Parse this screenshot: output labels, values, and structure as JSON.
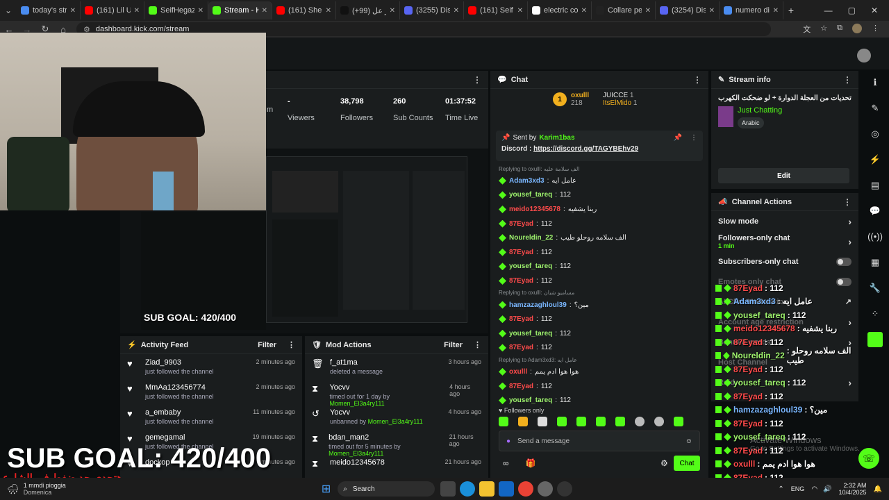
{
  "tabs": [
    {
      "label": "today's strea",
      "color": "#4a8cf0"
    },
    {
      "label": "(161) Lil Uzi",
      "color": "#ff0000"
    },
    {
      "label": "SeifHegazy",
      "color": "#53fc18"
    },
    {
      "label": "Stream - Kick",
      "color": "#53fc18",
      "active": true
    },
    {
      "label": "(161) Sherine",
      "color": "#ff0000"
    },
    {
      "label": "(+99) عائز عل",
      "color": "#111111"
    },
    {
      "label": "(3255) Disco",
      "color": "#5865f2"
    },
    {
      "label": "(161) Seif He",
      "color": "#ff0000"
    },
    {
      "label": "electric colla",
      "color": "#ffffff"
    },
    {
      "label": "Collare per",
      "color": "#222222"
    },
    {
      "label": "(3254) Disco",
      "color": "#5865f2"
    },
    {
      "label": "numero di u",
      "color": "#4a8cf0"
    }
  ],
  "browser": {
    "url": "dashboard.kick.com/stream"
  },
  "stats": [
    {
      "value": "-",
      "label": "Viewers"
    },
    {
      "value": "38,798",
      "label": "Followers"
    },
    {
      "value": "260",
      "label": "Sub Counts"
    },
    {
      "value": "01:37:52",
      "label": "Time Live"
    }
  ],
  "stats_cut_label": "m",
  "overlay": {
    "sub_goal": "SUB GOAL: 420/400",
    "sub_goal_small": "SUB GOAL: 420/400",
    "arabic": "هتحدي حد ضغط في الشارع"
  },
  "activity": {
    "title": "Activity Feed",
    "filter": "Filter",
    "items": [
      {
        "name": "Ziad_9903",
        "sub": "just followed the channel",
        "time": "2 minutes ago"
      },
      {
        "name": "MmAa123456774",
        "sub": "just followed the channel",
        "time": "2 minutes ago"
      },
      {
        "name": "a_embaby",
        "sub": "just followed the channel",
        "time": "11 minutes ago"
      },
      {
        "name": "gemegamal",
        "sub": "just followed the channel",
        "time": "19 minutes ago"
      },
      {
        "name": "dockop",
        "sub": "",
        "time": "minutes ago"
      }
    ]
  },
  "mod": {
    "title": "Mod Actions",
    "filter": "Filter",
    "items": [
      {
        "icon": "trash-icon",
        "glyph": "🗑",
        "name": "f_at1ma",
        "sub": "deleted a message",
        "by": "",
        "time": "3 hours ago"
      },
      {
        "icon": "hourglass-icon",
        "glyph": "⧗",
        "name": "Yocvv",
        "sub": "timed out for 1 day by ",
        "by": "Momen_El3a4ry111",
        "time": "4 hours ago"
      },
      {
        "icon": "unban-icon",
        "glyph": "↺",
        "name": "Yocvv",
        "sub": "unbanned by ",
        "by": "Momen_El3a4ry111",
        "time": "4 hours ago"
      },
      {
        "icon": "hourglass-icon",
        "glyph": "⧗",
        "name": "bdan_man2",
        "sub": "timed out for 5 minutes by ",
        "by": "Momen_El3a4ry111",
        "time": "21 hours ago"
      },
      {
        "icon": "hourglass-icon",
        "glyph": "⧗",
        "name": "meido12345678",
        "sub": "",
        "by": "",
        "time": "21 hours ago"
      }
    ]
  },
  "chat": {
    "title": "Chat",
    "leaderboard": [
      {
        "rank": "1",
        "name": "oxulll",
        "count": "218"
      },
      {
        "name": "JUICCE",
        "count": "1"
      },
      {
        "name": "ItsElMido",
        "count": "1"
      }
    ],
    "pinned": {
      "sent_by": "Sent by",
      "user": "Karim1bas",
      "text": "Discord : ",
      "link": "https://discord.gg/TAGYBEhv29"
    },
    "messages": [
      {
        "reply": "Replying to oxulll: الف سلامة عليه"
      },
      {
        "user": "Adam3xd3",
        "color": "u-blue",
        "text": "عامل ايه"
      },
      {
        "user": "yousef_tareq",
        "color": "u-green",
        "text": "112"
      },
      {
        "user": "meido12345678",
        "color": "u-red",
        "text": "ربنا يشفيه"
      },
      {
        "user": "87Eyad",
        "color": "u-red",
        "text": "112"
      },
      {
        "user": "Noureldin_22",
        "color": "u-green",
        "text": "الف سلامه روحلو طيب"
      },
      {
        "user": "87Eyad",
        "color": "u-red",
        "text": "112"
      },
      {
        "user": "yousef_tareq",
        "color": "u-green",
        "text": "112"
      },
      {
        "user": "87Eyad",
        "color": "u-red",
        "text": "112"
      },
      {
        "reply": "Replying to oxulll: مساميو شبان"
      },
      {
        "user": "hamzazaghloul39",
        "color": "u-blue",
        "text": "مين؟"
      },
      {
        "user": "87Eyad",
        "color": "u-red",
        "text": "112"
      },
      {
        "user": "yousef_tareq",
        "color": "u-green",
        "text": "112"
      },
      {
        "user": "87Eyad",
        "color": "u-red",
        "text": "112"
      },
      {
        "reply": "Replying to Adam3xd3: عامل ايه"
      },
      {
        "user": "oxulll",
        "color": "u-red",
        "text": "هوا هوا ادم يمم"
      },
      {
        "user": "87Eyad",
        "color": "u-red",
        "text": "112"
      },
      {
        "user": "yousef_tareq",
        "color": "u-green",
        "text": "112"
      }
    ],
    "followers_only": "Followers only",
    "placeholder": "Send a message",
    "send": "Chat"
  },
  "stream_info": {
    "title": "Stream info",
    "stream_title": "تحديات من العجلة الدوارة + لو ضحكت الكهرب",
    "category": "Just Chatting",
    "language": "Arabic",
    "edit": "Edit"
  },
  "channel_actions": {
    "title": "Channel Actions",
    "rows": [
      {
        "label": "Slow mode",
        "sub": "",
        "type": "chevron"
      },
      {
        "label": "Followers-only chat",
        "sub": "1 min",
        "type": "chevron"
      },
      {
        "label": "Subscribers-only chat",
        "sub": "",
        "type": "toggle"
      },
      {
        "label": "Emotes only chat",
        "sub": "",
        "type": "toggle"
      },
      {
        "label": "AI Chat Moderation",
        "sub": "",
        "type": "external"
      },
      {
        "label": "Account age restriction",
        "sub": "",
        "type": "chevron"
      },
      {
        "label": "Banned words",
        "sub": "",
        "type": "chevron"
      },
      {
        "label": "Host Channel",
        "sub": "",
        "type": "none"
      },
      {
        "label": "Raid",
        "sub": "",
        "type": "chevron"
      }
    ]
  },
  "overlay_chat": [
    {
      "user": "87Eyad",
      "color": "#ff4b4b",
      "text": ": 112"
    },
    {
      "user": "Adam3xd3",
      "color": "#7ab7ff",
      "text": ": عامل ايه"
    },
    {
      "user": "yousef_tareq",
      "color": "#9ef26d",
      "text": ": 112"
    },
    {
      "user": "meido12345678",
      "color": "#ff4b4b",
      "text": ": ربنا يشفيه"
    },
    {
      "user": "87Eyad",
      "color": "#ff4b4b",
      "text": ": 112"
    },
    {
      "user": "Noureldin_22",
      "color": "#9ef26d",
      "text": ": الف سلامه روحلو طيب"
    },
    {
      "user": "87Eyad",
      "color": "#ff4b4b",
      "text": ": 112"
    },
    {
      "user": "yousef_tareq",
      "color": "#9ef26d",
      "text": ": 112"
    },
    {
      "user": "87Eyad",
      "color": "#ff4b4b",
      "text": ": 112"
    },
    {
      "user": "hamzazaghloul39",
      "color": "#7ab7ff",
      "text": ": مين؟"
    },
    {
      "user": "87Eyad",
      "color": "#ff4b4b",
      "text": ": 112"
    },
    {
      "user": "yousef_tareq",
      "color": "#9ef26d",
      "text": ": 112"
    },
    {
      "user": "87Eyad",
      "color": "#ff4b4b",
      "text": ": 112"
    },
    {
      "user": "oxulll",
      "color": "#ff4b4b",
      "text": ": هوا هوا ادم يمم"
    },
    {
      "user": "87Eyad",
      "color": "#ff4b4b",
      "text": ": 112"
    },
    {
      "user": "yousef_tareq",
      "color": "#9ef26d",
      "text": ": 112"
    }
  ],
  "windows_watermark": "Activate Windows",
  "windows_watermark_sub": "Go to Settings to activate Windows.",
  "taskbar": {
    "weather": "1 mmdi pioggia",
    "weather_sub": "Domenica",
    "search": "Search",
    "lang": "ENG",
    "time": "2:32 AM",
    "date": "10/4/2025"
  }
}
